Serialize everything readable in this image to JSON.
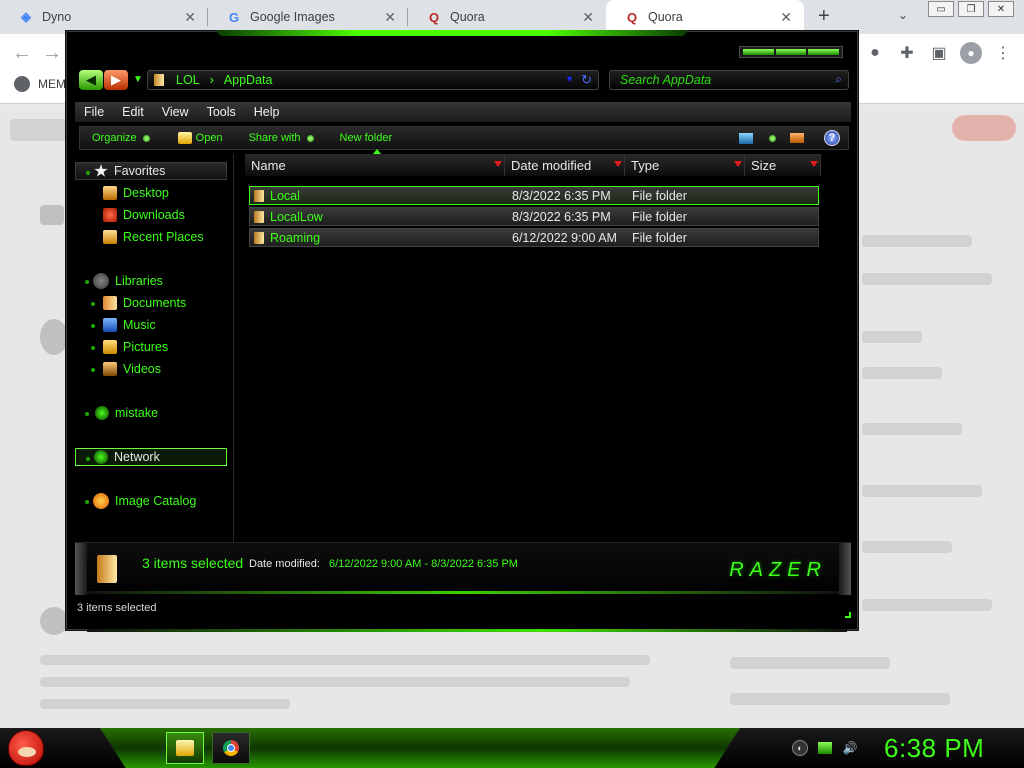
{
  "browser": {
    "tabs": [
      {
        "title": "Dyno",
        "icon": "dyno-icon"
      },
      {
        "title": "Google Images",
        "icon": "google-icon"
      },
      {
        "title": "Quora",
        "icon": "quora-icon"
      },
      {
        "title": "Quora",
        "icon": "quora-icon"
      }
    ],
    "new_tab": "+",
    "tab_search": "⌄",
    "bookmark": "MEM",
    "window_buttons": [
      "▭",
      "❐",
      "✕"
    ],
    "close_glyph": "✕"
  },
  "explorer": {
    "address": {
      "crumbs": [
        "LOL",
        "AppData"
      ],
      "sep": "›"
    },
    "search_placeholder": "Search AppData",
    "menu": [
      "File",
      "Edit",
      "View",
      "Tools",
      "Help"
    ],
    "commands": {
      "organize": "Organize",
      "open": "Open",
      "share_with": "Share with",
      "new_folder": "New folder",
      "help": "?"
    },
    "nav": {
      "favorites": "Favorites",
      "desktop": "Desktop",
      "downloads": "Downloads",
      "recent": "Recent Places",
      "libraries": "Libraries",
      "documents": "Documents",
      "music": "Music",
      "pictures": "Pictures",
      "videos": "Videos",
      "mistake": "mistake",
      "network": "Network",
      "image_catalog": "Image Catalog"
    },
    "columns": {
      "name": "Name",
      "date": "Date modified",
      "type": "Type",
      "size": "Size"
    },
    "files": [
      {
        "name": "Local",
        "date": "8/3/2022 6:35 PM",
        "type": "File folder"
      },
      {
        "name": "LocalLow",
        "date": "8/3/2022 6:35 PM",
        "type": "File folder"
      },
      {
        "name": "Roaming",
        "date": "6/12/2022 9:00 AM",
        "type": "File folder"
      }
    ],
    "details": {
      "count": "3 items selected",
      "date_label": "Date modified:",
      "date_value": "6/12/2022 9:00 AM - 8/3/2022 6:35 PM",
      "brand": "RAZER"
    },
    "status": "3 items selected"
  },
  "taskbar": {
    "clock": "6:38 PM"
  },
  "colors": {
    "accent": "#3dff1a",
    "window_bg": "#000000"
  }
}
